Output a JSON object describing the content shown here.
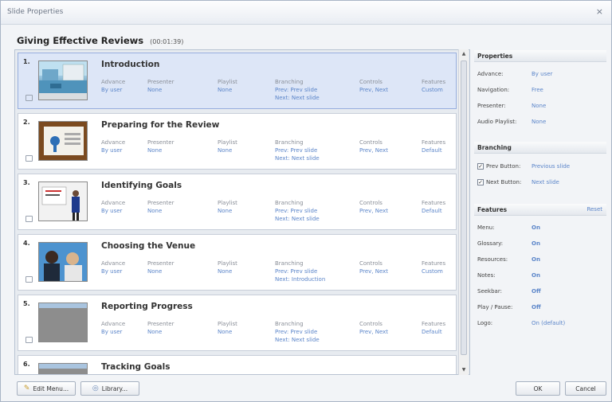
{
  "window": {
    "title": "Slide Properties",
    "close_glyph": "×"
  },
  "course": {
    "title": "Giving Effective Reviews",
    "duration": "(00:01:39)"
  },
  "column_labels": {
    "advance": "Advance",
    "presenter": "Presenter",
    "playlist": "Playlist",
    "branching": "Branching",
    "controls": "Controls",
    "features": "Features"
  },
  "slides": [
    {
      "num": "1.",
      "title": "Introduction",
      "advance": "By user",
      "presenter": "None",
      "playlist": "None",
      "prev": "Prev: Prev slide",
      "next": "Next: Next slide",
      "controls": "Prev, Next",
      "features": "Custom"
    },
    {
      "num": "2.",
      "title": "Preparing for the Review",
      "advance": "By user",
      "presenter": "None",
      "playlist": "None",
      "prev": "Prev: Prev slide",
      "next": "Next: Next slide",
      "controls": "Prev, Next",
      "features": "Default"
    },
    {
      "num": "3.",
      "title": "Identifying Goals",
      "advance": "By user",
      "presenter": "None",
      "playlist": "None",
      "prev": "Prev: Prev slide",
      "next": "Next: Next slide",
      "controls": "Prev, Next",
      "features": "Default"
    },
    {
      "num": "4.",
      "title": "Choosing the Venue",
      "advance": "By user",
      "presenter": "None",
      "playlist": "None",
      "prev": "Prev: Prev slide",
      "next": "Next: Introduction",
      "controls": "Prev, Next",
      "features": "Custom"
    },
    {
      "num": "5.",
      "title": "Reporting Progress",
      "advance": "By user",
      "presenter": "None",
      "playlist": "None",
      "prev": "Prev: Prev slide",
      "next": "Next: Next slide",
      "controls": "Prev, Next",
      "features": "Default"
    },
    {
      "num": "6.",
      "title": "Tracking Goals"
    }
  ],
  "properties": {
    "heading": "Properties",
    "rows": [
      {
        "label": "Advance:",
        "value": "By user"
      },
      {
        "label": "Navigation:",
        "value": "Free"
      },
      {
        "label": "Presenter:",
        "value": "None"
      },
      {
        "label": "Audio Playlist:",
        "value": "None"
      }
    ]
  },
  "branching": {
    "heading": "Branching",
    "prev_label": "Prev Button:",
    "prev_value": "Previous slide",
    "next_label": "Next Button:",
    "next_value": "Next slide",
    "check_glyph": "✓"
  },
  "features": {
    "heading": "Features",
    "reset": "Reset",
    "rows": [
      {
        "label": "Menu:",
        "value": "On"
      },
      {
        "label": "Glossary:",
        "value": "On"
      },
      {
        "label": "Resources:",
        "value": "On"
      },
      {
        "label": "Notes:",
        "value": "On"
      },
      {
        "label": "Seekbar:",
        "value": "Off"
      },
      {
        "label": "Play / Pause:",
        "value": "Off"
      },
      {
        "label": "Logo:",
        "value": "On (default)"
      }
    ]
  },
  "footer": {
    "edit_menu": "Edit Menu...",
    "library": "Library...",
    "ok": "OK",
    "cancel": "Cancel"
  },
  "colors": {
    "link": "#5b85c9",
    "selected_row": "#dde6f7"
  }
}
